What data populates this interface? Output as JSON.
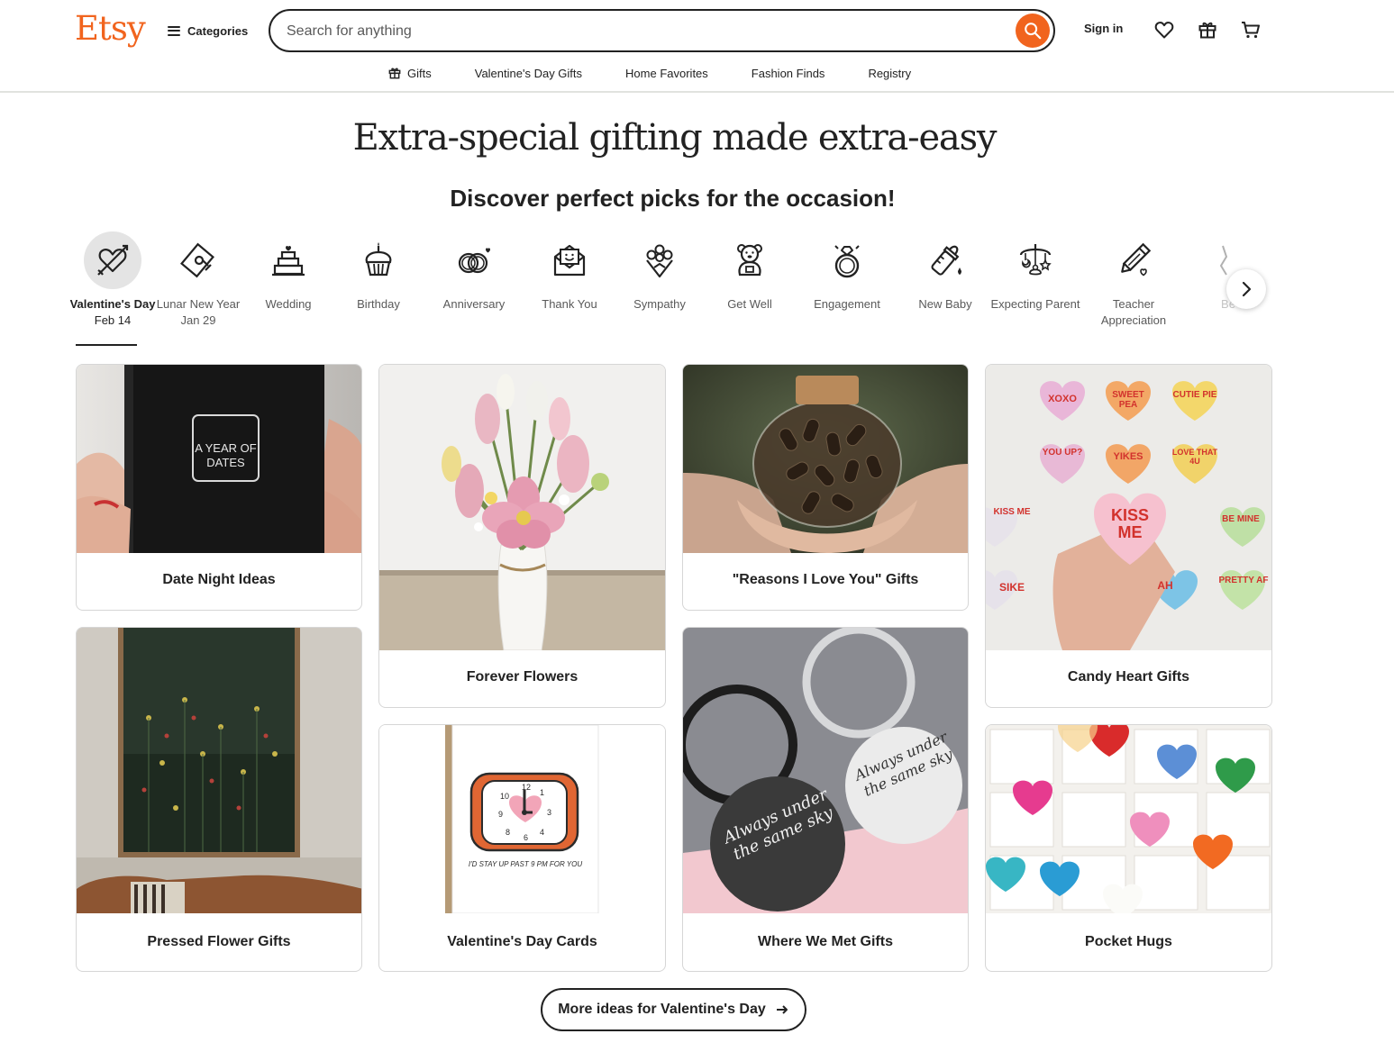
{
  "header": {
    "logo": "Etsy",
    "categories_label": "Categories",
    "search_placeholder": "Search for anything",
    "signin_label": "Sign in"
  },
  "subnav": {
    "items": [
      "Gifts",
      "Valentine's Day Gifts",
      "Home Favorites",
      "Fashion Finds",
      "Registry"
    ]
  },
  "hero": {
    "title": "Extra-special gifting made extra-easy",
    "subtitle": "Discover perfect picks for the occasion!"
  },
  "occasions": [
    {
      "label": "Valentine's Day",
      "date": "Feb 14",
      "icon": "heart-arrow-icon",
      "active": true
    },
    {
      "label": "Lunar New Year",
      "date": "Jan 29",
      "icon": "lunar-envelope-icon"
    },
    {
      "label": "Wedding",
      "icon": "wedding-cake-icon"
    },
    {
      "label": "Birthday",
      "icon": "cupcake-icon"
    },
    {
      "label": "Anniversary",
      "icon": "rings-icon"
    },
    {
      "label": "Thank You",
      "icon": "envelope-smile-icon"
    },
    {
      "label": "Sympathy",
      "icon": "bouquet-icon"
    },
    {
      "label": "Get Well",
      "icon": "teddy-bear-icon"
    },
    {
      "label": "Engagement",
      "icon": "ring-icon"
    },
    {
      "label": "New Baby",
      "icon": "baby-bottle-icon"
    },
    {
      "label": "Expecting Parent",
      "icon": "baby-mobile-icon"
    },
    {
      "label": "Teacher Appreciation",
      "icon": "pencil-heart-icon"
    },
    {
      "label": "Be",
      "icon": "partial-icon"
    }
  ],
  "cards": [
    {
      "label": "Date Night Ideas",
      "image_text": "A YEAR OF DATES"
    },
    {
      "label": "Forever Flowers"
    },
    {
      "label": "\"Reasons I Love You\" Gifts"
    },
    {
      "label": "Candy Heart Gifts",
      "hearts": [
        "XOXO",
        "SWEET PEA",
        "CUTIE PIE",
        "YOU UP?",
        "YIKES",
        "LOVE THAT 4U",
        "KISS ME",
        "BE MINE",
        "SIKE",
        "AH",
        "PRETTY AF",
        "KISS ME"
      ]
    },
    {
      "label": "Pressed Flower Gifts"
    },
    {
      "label": "Valentine's Day Cards",
      "image_text": "I'D STAY UP PAST 9 PM FOR YOU"
    },
    {
      "label": "Where We Met Gifts",
      "image_text": "Always under the same sky"
    },
    {
      "label": "Pocket Hugs"
    }
  ],
  "cta": {
    "label": "More ideas for Valentine's Day"
  },
  "colors": {
    "brand": "#f1641e",
    "text": "#222222",
    "muted": "#595959",
    "border": "#d6d6d6"
  }
}
